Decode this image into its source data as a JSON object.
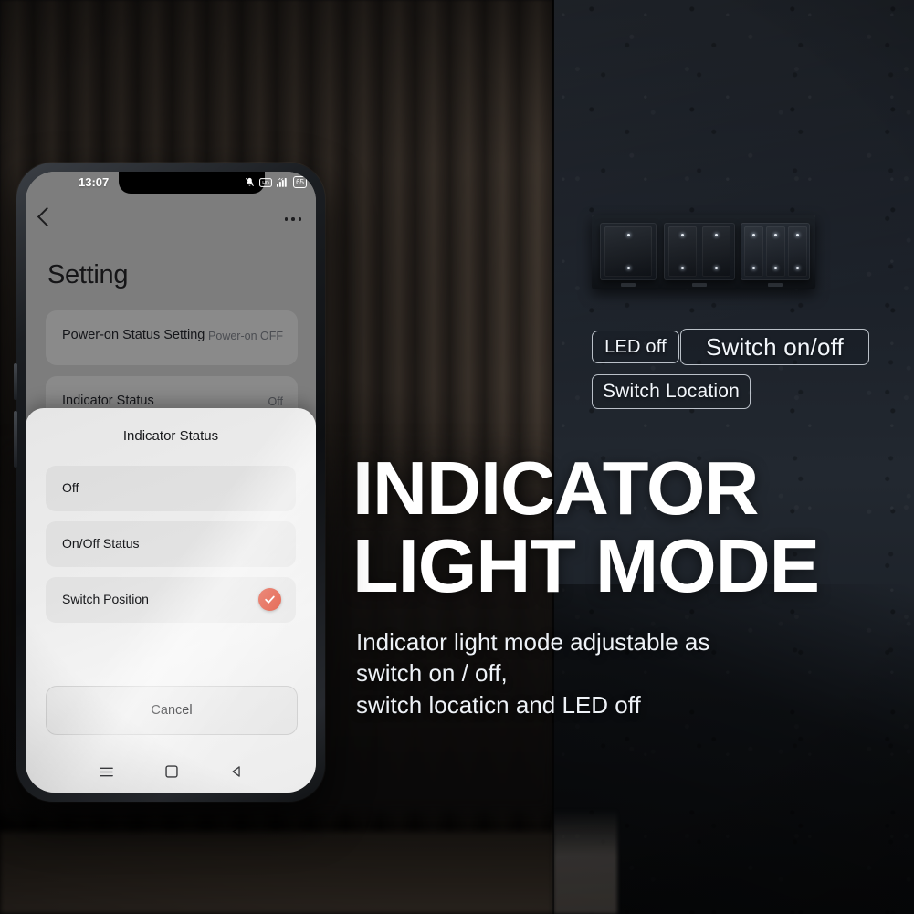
{
  "marketing": {
    "headline_line1": "INDICATOR",
    "headline_line2": "LIGHT MODE",
    "body_line1": "Indicator light mode adjustable as",
    "body_line2": "switch on / off,",
    "body_line3": "switch locaticn and LED off",
    "badges": [
      {
        "label": "LED off"
      },
      {
        "label": "Switch on/off"
      },
      {
        "label": "Switch Location"
      }
    ],
    "colors": {
      "headline": "#ffffff",
      "body": "#eef2f7",
      "badge_border": "#e8eef6",
      "wall_left": "#3a322a",
      "wall_right": "#222830"
    }
  },
  "phone": {
    "status_bar": {
      "time": "13:07",
      "battery_level": "65",
      "icons": [
        "bell-muted-icon",
        "hd-icon",
        "signal-bars-icon",
        "battery-icon"
      ]
    },
    "app_bar": {
      "back_icon": "chevron-left-icon",
      "more_icon": "more-options-icon"
    },
    "page_title": "Setting",
    "settings_rows": [
      {
        "label": "Power-on Status Setting",
        "value": "Power-on OFF"
      },
      {
        "label": "Indicator Status",
        "value": "Off"
      }
    ],
    "sheet": {
      "title": "Indicator Status",
      "options": [
        {
          "label": "Off",
          "selected": false
        },
        {
          "label": "On/Off Status",
          "selected": false
        },
        {
          "label": "Switch Position",
          "selected": true
        }
      ],
      "selected_color": "#e04a32",
      "cancel_label": "Cancel"
    },
    "nav_bar": {
      "menu_icon": "menu-icon",
      "home_icon": "home-square-icon",
      "back_icon": "back-triangle-icon"
    }
  }
}
